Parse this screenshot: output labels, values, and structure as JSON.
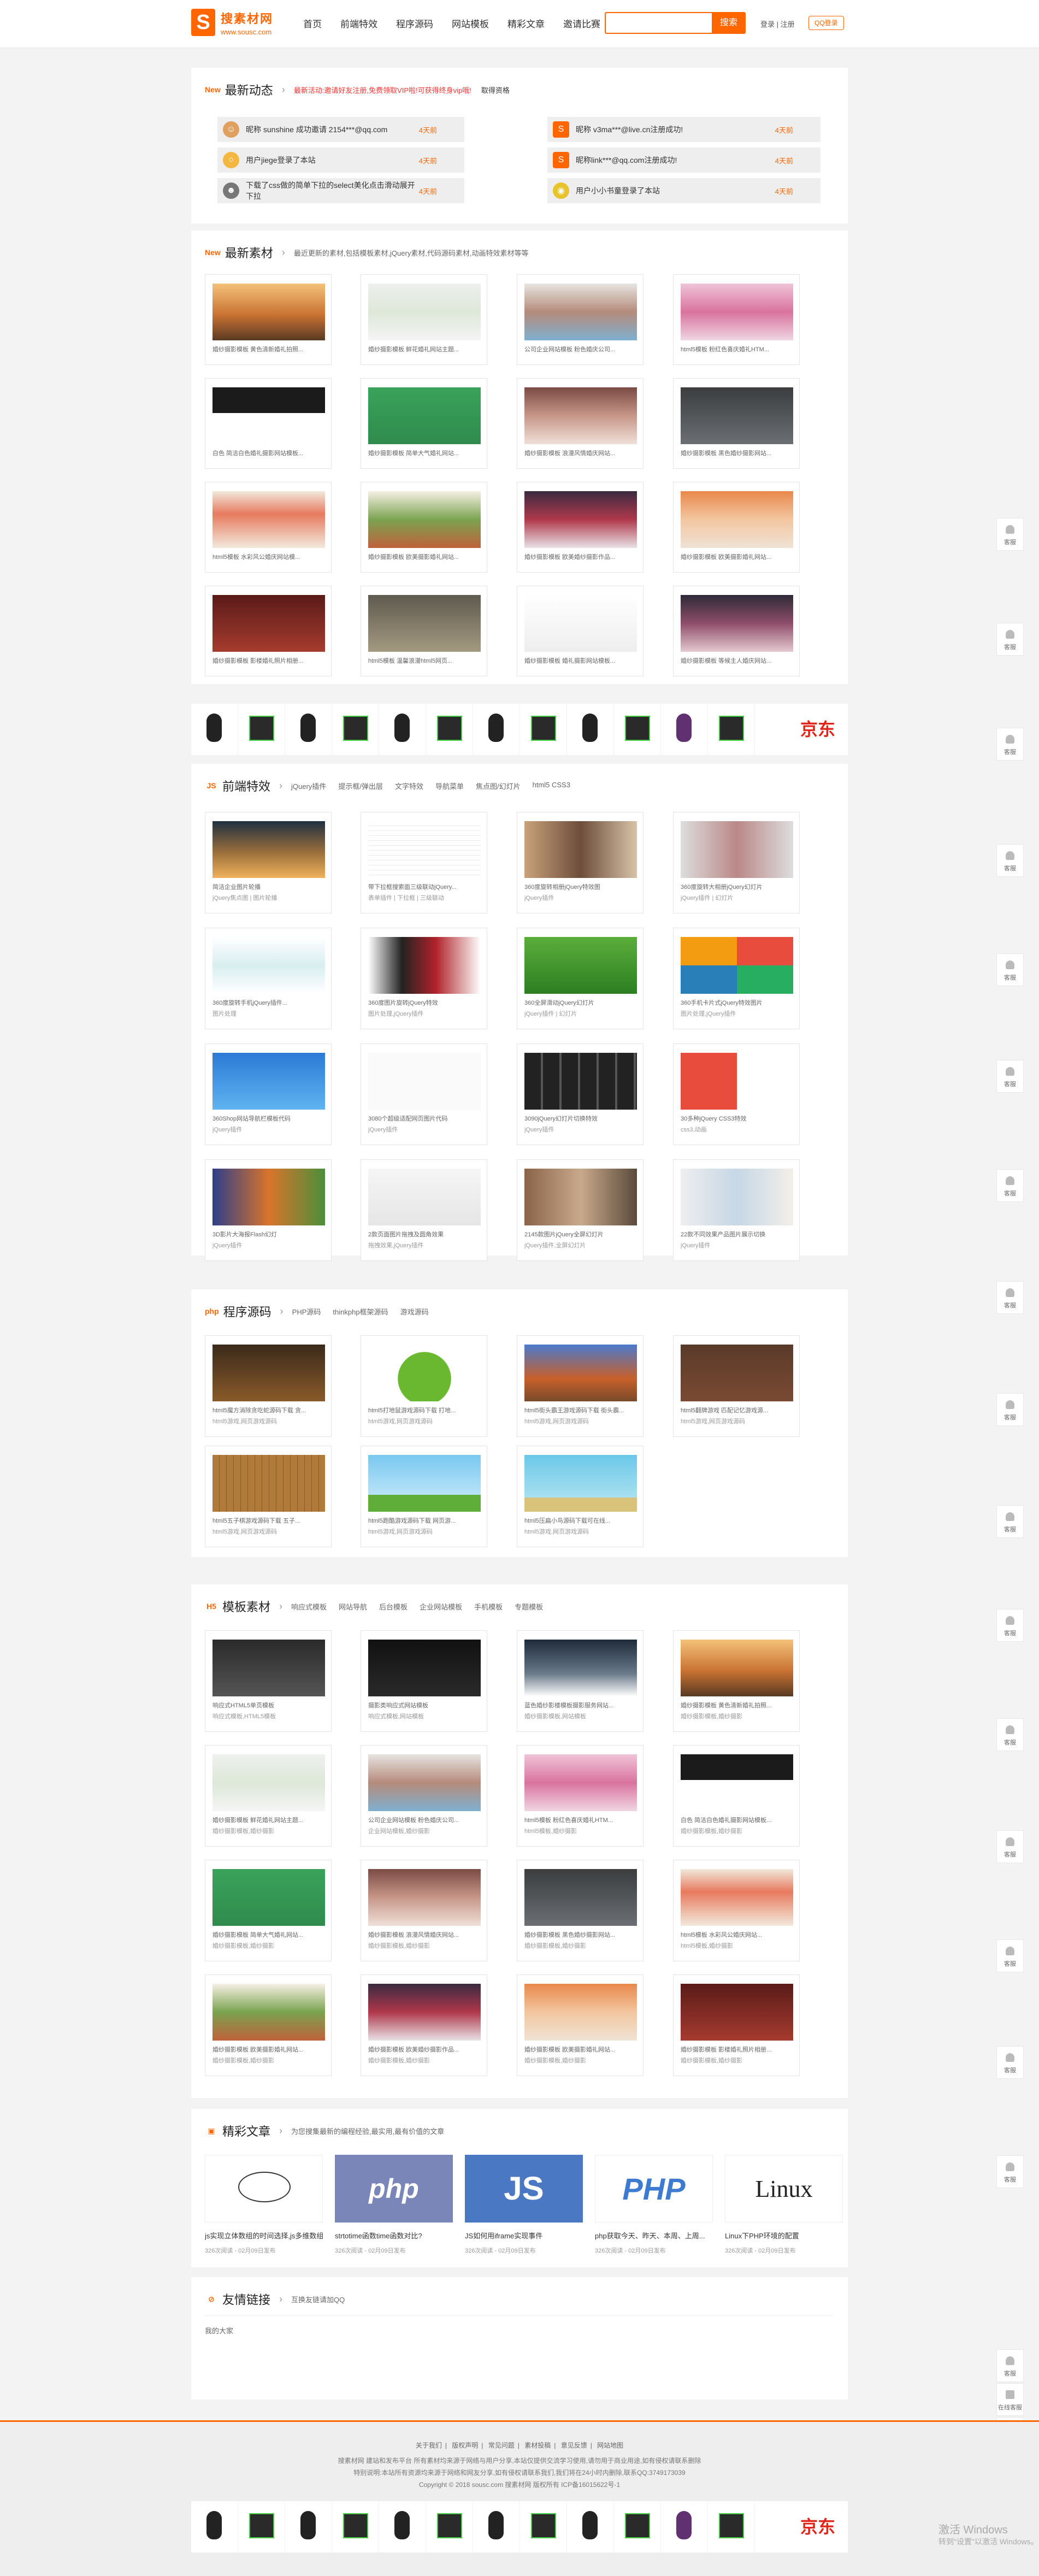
{
  "header": {
    "logo_char": "S",
    "logo_name": "搜素材网",
    "logo_url": "www.sousc.com",
    "nav": [
      "首页",
      "前端特效",
      "程序源码",
      "网站模板",
      "精彩文章",
      "邀请比赛"
    ],
    "search_btn": "搜索",
    "login": "登录",
    "sep": "|",
    "register": "注册",
    "qq_login": "QQ登录"
  },
  "news": {
    "icon": "New",
    "title": "最新动态",
    "arrow": "›",
    "notice": "最新活动:邀请好友注册,免费领取VIP啦!可获得终身vip哦!",
    "more": "取得资格",
    "items": [
      {
        "text": "昵称 sunshine 成功邀请 2154***@qq.com",
        "time": "4天前"
      },
      {
        "text": "昵称 v3ma***@live.cn注册成功!",
        "time": "4天前"
      },
      {
        "text": "用户jiege登录了本站",
        "time": "4天前"
      },
      {
        "text": "昵称link***@qq.com注册成功!",
        "time": "4天前"
      },
      {
        "text": "下载了css做的简单下拉的select美化点击滑动展开下拉",
        "time": "4天前"
      },
      {
        "text": "用户小小书童登录了本站",
        "time": "4天前"
      }
    ]
  },
  "latest": {
    "icon": "New",
    "title": "最新素材",
    "arrow": "›",
    "desc": "最近更新的素材,包括模板素材,jQuery素材,代码源码素材,动画特效素材等等",
    "items": [
      "婚纱摄影模板 黄色清新婚礼拍照...",
      "婚纱摄影模板 鲜花婚礼网站主题...",
      "公司企业网站模板 粉色婚庆公司...",
      "html5模板 粉红色喜庆婚礼HTM...",
      "白色 简洁白色婚礼摄影网站模板...",
      "婚纱摄影模板 简单大气婚礼网站...",
      "婚纱摄影模板 浪漫风情婚庆网站...",
      "婚纱摄影模板 黑色婚纱摄影网站...",
      "html5模板 水彩风公婚庆网站模...",
      "婚纱摄影模板 欧美摄影婚礼网站...",
      "婚纱摄影模板 欧美婚纱摄影作品...",
      "婚纱摄影模板 欧美摄影婚礼网站...",
      "婚纱摄影模板 影楼婚礼照片相册...",
      "html5模板 温馨浪漫html5网页...",
      "婚纱摄影模板 婚礼摄影网站模板...",
      "婚纱摄影模板 等候主人婚庆网站..."
    ]
  },
  "frontend": {
    "icon": "JS",
    "title": "前端特效",
    "arrow": "›",
    "tags": [
      "jQuery插件",
      "提示框/弹出层",
      "文字特效",
      "导航菜单",
      "焦点图/幻灯片",
      "html5 CSS3"
    ],
    "items": [
      {
        "t": "简洁企业图片轮播",
        "s": "jQuery焦点图 | 图片轮播"
      },
      {
        "t": "带下拉框搜索面三级联动jQuery...",
        "s": "表单插件 | 下拉框 | 三级联动"
      },
      {
        "t": "360度旋转相册jQuery特效图",
        "s": "jQuery插件"
      },
      {
        "t": "360度旋转大相册jQuery幻灯片",
        "s": "jQuery插件 | 幻灯片"
      },
      {
        "t": "360度旋转手机jQuery插件...",
        "s": "图片处理"
      },
      {
        "t": "360度图片旋转jQuery特效",
        "s": "图片处理,jQuery插件"
      },
      {
        "t": "360全屏滑动jQuery幻灯片",
        "s": "jQuery插件 | 幻灯片"
      },
      {
        "t": "360手机卡片式jQuery特效图片",
        "s": "图片处理,jQuery插件"
      },
      {
        "t": "360Shop网站导航栏模板代码",
        "s": "jQuery插件"
      },
      {
        "t": "3080个超级适配网页图片代码",
        "s": "jQuery插件"
      },
      {
        "t": "3090jQuery幻灯片切换特效",
        "s": "jQuery插件"
      },
      {
        "t": "30多种jQuery CSS3特效",
        "s": "css3,动画"
      },
      {
        "t": "3D影片大海报Flash幻灯",
        "s": "jQuery插件"
      },
      {
        "t": "2款页面图片拖拽及圆角效果",
        "s": "拖拽效果,jQuery插件"
      },
      {
        "t": "2145款图片jQuery全屏幻灯片",
        "s": "jQuery插件,全屏幻灯片"
      },
      {
        "t": "22款不同效果产品图片展示切换",
        "s": "jQuery插件"
      }
    ]
  },
  "source": {
    "icon": "php",
    "title": "程序源码",
    "arrow": "›",
    "tags": [
      "PHP源码",
      "thinkphp框架源码",
      "游戏源码"
    ],
    "items": [
      {
        "t": "html5魔方消除贪吃蛇源码下载 贪...",
        "s": "html5游戏,网页游戏源码"
      },
      {
        "t": "html5打地鼠游戏源码下载 打地...",
        "s": "html5游戏,网页游戏源码"
      },
      {
        "t": "html5街头霸王游戏源码下载 街头霸...",
        "s": "html5游戏,网页游戏源码"
      },
      {
        "t": "html5翻牌游戏 匹配记忆游戏源...",
        "s": "html5游戏,网页游戏源码"
      },
      {
        "t": "html5五子棋游戏源码下载 五子...",
        "s": "html5游戏,网页游戏源码"
      },
      {
        "t": "html5跑酷游戏源码下载 网页游...",
        "s": "html5游戏,网页游戏源码"
      },
      {
        "t": "html5压扁小鸟源码下载可在线...",
        "s": "html5游戏,网页游戏源码"
      }
    ]
  },
  "templates": {
    "icon": "H5",
    "title": "模板素材",
    "arrow": "›",
    "tags": [
      "响应式模板",
      "网站导航",
      "后台模板",
      "企业网站模板",
      "手机模板",
      "专题模板"
    ],
    "items": [
      {
        "t": "响应式HTML5单页模板",
        "s": "响应式模板,HTML5模板"
      },
      {
        "t": "摄影类响应式网站模板",
        "s": "响应式模板,网站模板"
      },
      {
        "t": "蓝色婚纱影楼模板摄影服务网站...",
        "s": "婚纱摄影模板,网站模板"
      },
      {
        "t": "婚纱摄影模板 黄色清新婚礼拍照...",
        "s": "婚纱摄影模板,婚纱摄影"
      },
      {
        "t": "婚纱摄影模板 鲜花婚礼网站主题...",
        "s": "婚纱摄影模板,婚纱摄影"
      },
      {
        "t": "公司企业网站模板 粉色婚庆公司...",
        "s": "企业网站模板,婚纱摄影"
      },
      {
        "t": "html5模板 粉红色喜庆婚礼HTM...",
        "s": "html5模板,婚纱摄影"
      },
      {
        "t": "白色 简洁白色婚礼摄影网站模板...",
        "s": "婚纱摄影模板,婚纱摄影"
      },
      {
        "t": "婚纱摄影模板 简单大气婚礼网站...",
        "s": "婚纱摄影模板,婚纱摄影"
      },
      {
        "t": "婚纱摄影模板 浪漫风情婚庆网站...",
        "s": "婚纱摄影模板,婚纱摄影"
      },
      {
        "t": "婚纱摄影模板 黑色婚纱摄影网站...",
        "s": "婚纱摄影模板,婚纱摄影"
      },
      {
        "t": "html5模板 水彩风公婚庆网站...",
        "s": "html5模板,婚纱摄影"
      },
      {
        "t": "婚纱摄影模板 欧美摄影婚礼网站...",
        "s": "婚纱摄影模板,婚纱摄影"
      },
      {
        "t": "婚纱摄影模板 欧美婚纱摄影作品...",
        "s": "婚纱摄影模板,婚纱摄影"
      },
      {
        "t": "婚纱摄影模板 欧美摄影婚礼网站...",
        "s": "婚纱摄影模板,婚纱摄影"
      },
      {
        "t": "婚纱摄影模板 影楼婚礼照片相册...",
        "s": "婚纱摄影模板,婚纱摄影"
      }
    ]
  },
  "articles": {
    "title": "精彩文章",
    "arrow": "›",
    "desc": "为您搜集最新的编程经验,最实用,最有价值的文章",
    "items": [
      {
        "t": "js实现立体数组的时间选择,js多维数组",
        "s": "326次阅读 - 02月09日发布",
        "logo": ""
      },
      {
        "t": "strtotime函数time函数对比?",
        "s": "326次阅读 - 02月09日发布",
        "logo": "php"
      },
      {
        "t": "JS如何用iframe实现事件",
        "s": "326次阅读 - 02月09日发布",
        "logo": "JS"
      },
      {
        "t": "php获取今天、昨天、本周、上周...",
        "s": "326次阅读 - 02月09日发布",
        "logo": "PHP"
      },
      {
        "t": "Linux下PHP环境的配置",
        "s": "326次阅读 - 02月09日发布",
        "logo": "Linux"
      }
    ]
  },
  "friends": {
    "title": "友情链接",
    "arrow": "›",
    "desc": "互换友链请加QQ",
    "link": "我的大家"
  },
  "side": {
    "label": "客服",
    "feedback": "在线客服"
  },
  "ad": {
    "jd": "京东"
  },
  "footer": {
    "links": [
      "关于我们",
      "版权声明",
      "常见问题",
      "素材投稿",
      "意见反馈",
      "网站地图"
    ],
    "line1": "搜素材网 建站和发布平台 所有素材均来源于网络与用户分享,本站仅提供交流学习使用,请勿用于商业用途,如有侵权请联系删除",
    "line2": "特别说明:本站所有资源均来源于网络和网友分享,如有侵权请联系我们,我们将在24小时内删除,联系QQ:3749173039",
    "line3": "Copyright © 2018 sousc.com 搜素材网 版权所有 ICP备16015622号-1"
  },
  "watermark": {
    "line1": "激活 Windows",
    "line2": "转到\"设置\"以激活 Windows。"
  }
}
